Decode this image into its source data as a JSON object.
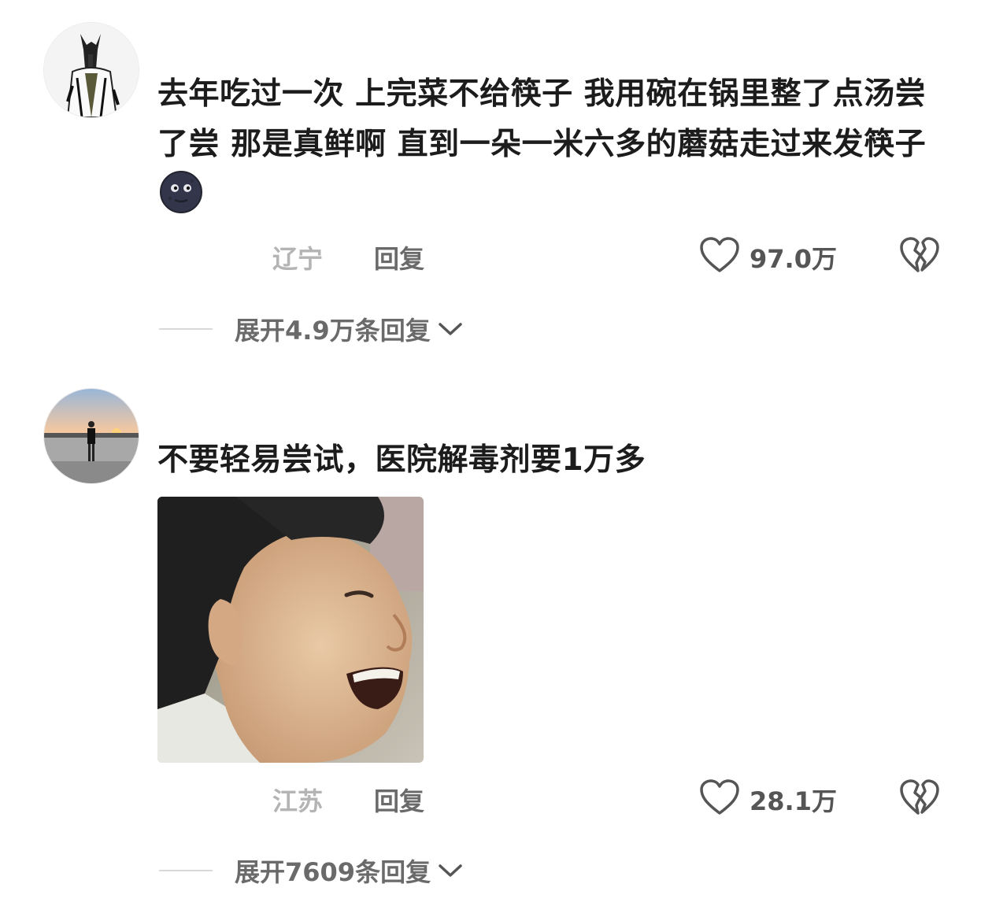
{
  "comments": [
    {
      "text": "去年吃过一次 上完菜不给筷子 我用碗在锅里整了点汤尝了尝 那是真鲜啊 直到一朵一米六多的蘑菇走过来发筷子",
      "emoji": "new-moon-face-emoji",
      "location": "辽宁",
      "reply_label": "回复",
      "likes": "97.0万",
      "expand_label": "展开4.9万条回复"
    },
    {
      "text": "不要轻易尝试，医院解毒剂要1万多",
      "sticker": "laughing-man-sticker",
      "location": "江苏",
      "reply_label": "回复",
      "likes": "28.1万",
      "expand_label": "展开7609条回复"
    }
  ],
  "icons": {
    "like": "heart-outline-icon",
    "dislike": "broken-heart-icon",
    "expand": "chevron-down-icon"
  },
  "colors": {
    "text": "#1c1c1c",
    "meta": "#6a6a6a",
    "location": "#b4b4b4"
  }
}
